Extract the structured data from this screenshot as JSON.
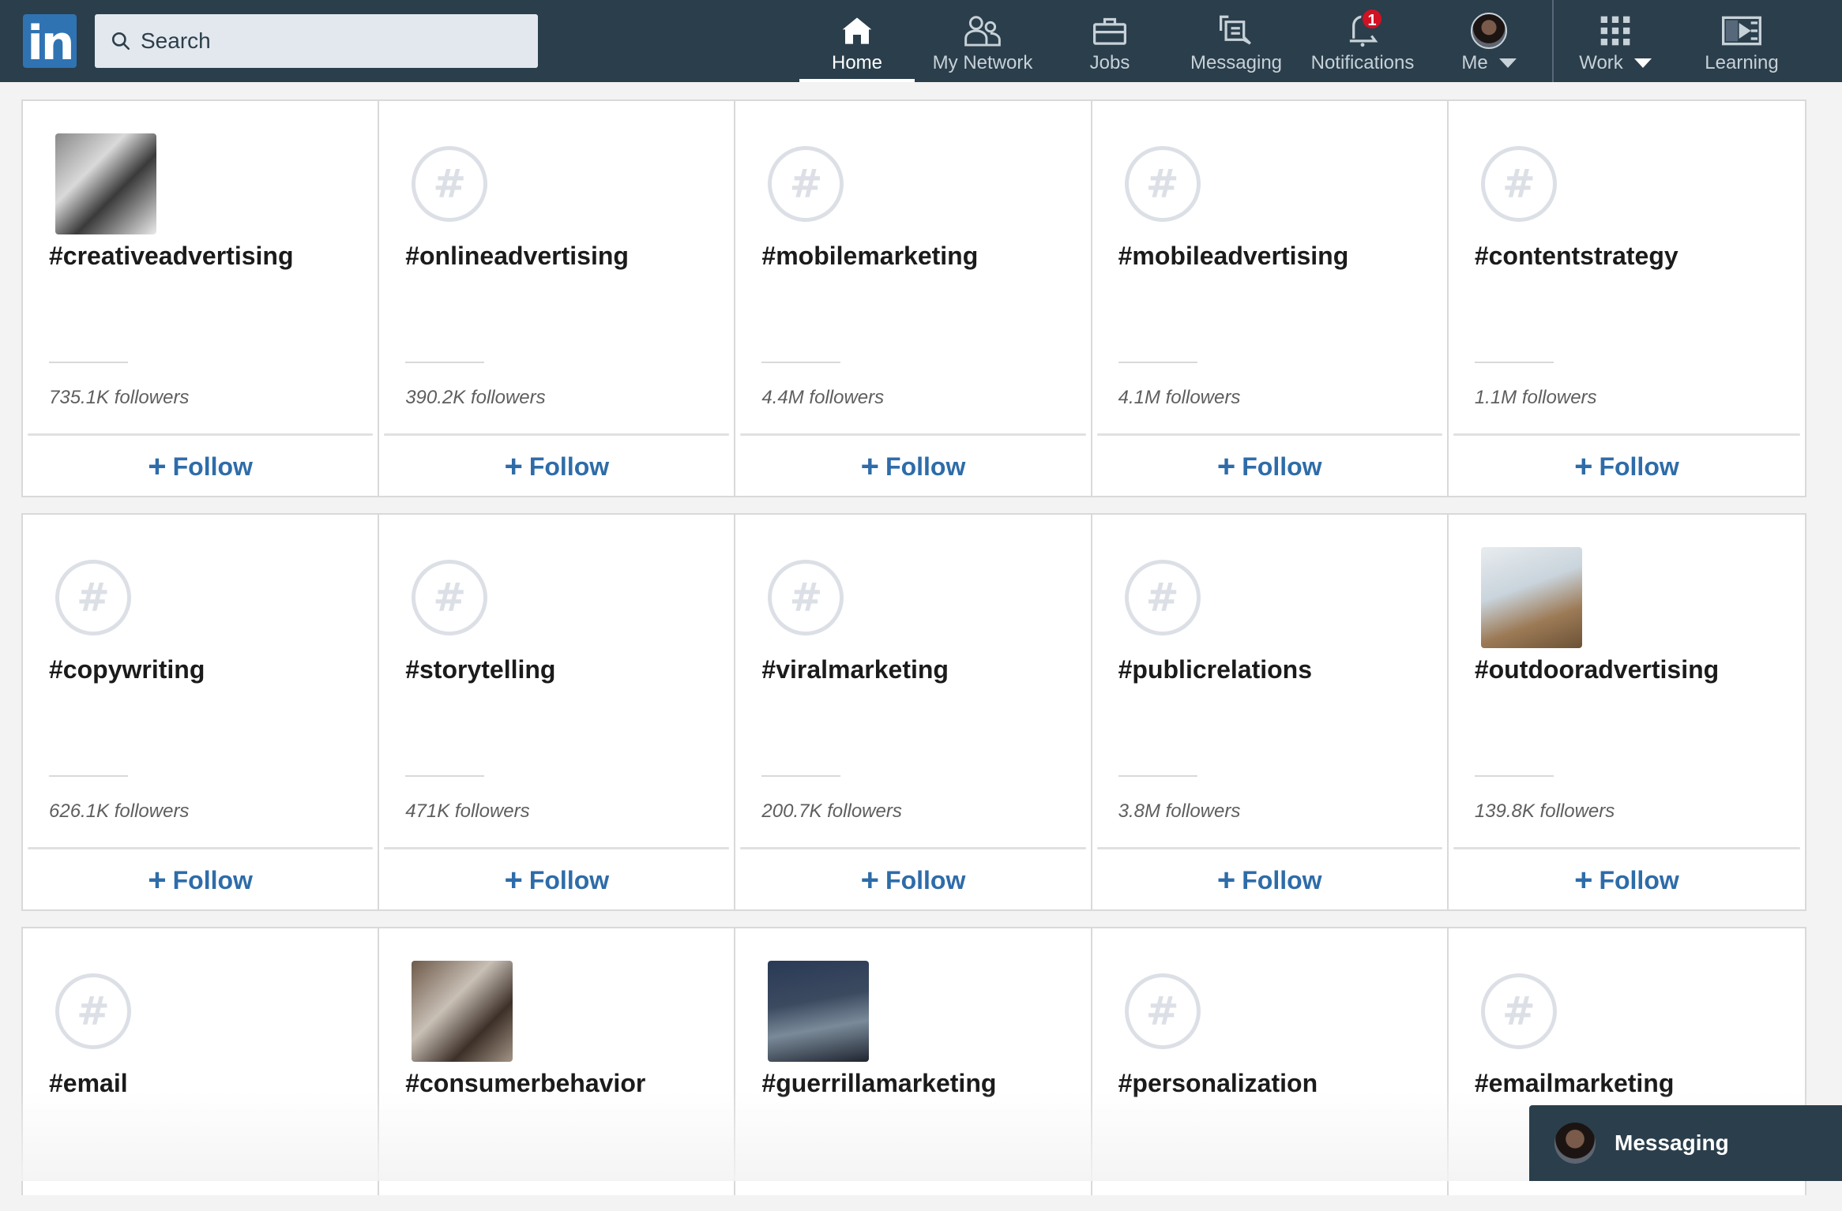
{
  "header": {
    "logo": "in",
    "search_placeholder": "Search",
    "nav": [
      {
        "label": "Home",
        "icon": "home-icon",
        "active": true
      },
      {
        "label": "My Network",
        "icon": "people-icon"
      },
      {
        "label": "Jobs",
        "icon": "briefcase-icon"
      },
      {
        "label": "Messaging",
        "icon": "chat-icon"
      },
      {
        "label": "Notifications",
        "icon": "bell-icon",
        "badge": "1"
      },
      {
        "label": "Me",
        "icon": "avatar"
      },
      {
        "label": "Work",
        "icon": "grid-icon"
      },
      {
        "label": "Learning",
        "icon": "play-icon"
      }
    ]
  },
  "follow_label": "Follow",
  "hashtags": [
    {
      "tag": "#creativeadvertising",
      "followers": "735.1K followers",
      "image": "photo"
    },
    {
      "tag": "#onlineadvertising",
      "followers": "390.2K followers"
    },
    {
      "tag": "#mobilemarketing",
      "followers": "4.4M followers"
    },
    {
      "tag": "#mobileadvertising",
      "followers": "4.1M followers"
    },
    {
      "tag": "#contentstrategy",
      "followers": "1.1M followers"
    },
    {
      "tag": "#copywriting",
      "followers": "626.1K followers"
    },
    {
      "tag": "#storytelling",
      "followers": "471K followers"
    },
    {
      "tag": "#viralmarketing",
      "followers": "200.7K followers"
    },
    {
      "tag": "#publicrelations",
      "followers": "3.8M followers"
    },
    {
      "tag": "#outdooradvertising",
      "followers": "139.8K followers",
      "image": "photo"
    },
    {
      "tag": "#email"
    },
    {
      "tag": "#consumerbehavior",
      "image": "photo"
    },
    {
      "tag": "#guerrillamarketing",
      "image": "photo"
    },
    {
      "tag": "#personalization"
    },
    {
      "tag": "#emailmarketing"
    }
  ],
  "messaging_bar": {
    "label": "Messaging"
  },
  "colors": {
    "header_bg": "#2b3e4b",
    "link_blue": "#2e6ca9",
    "logo_blue": "#2f73b3",
    "badge_red": "#d11124"
  }
}
